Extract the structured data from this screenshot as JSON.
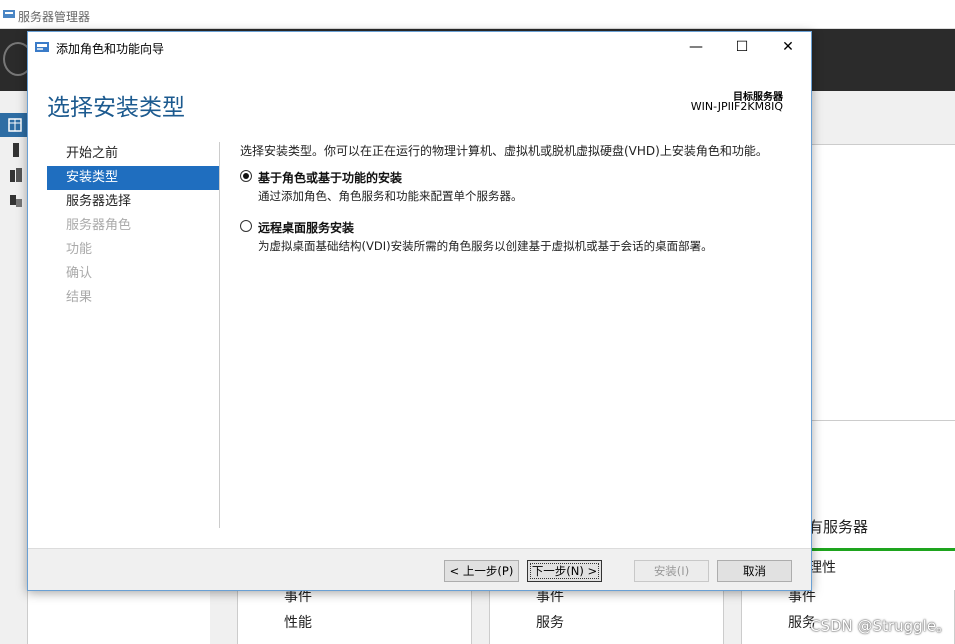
{
  "background": {
    "app_title": "服务器管理器",
    "tiles": [
      {
        "line1": "事件",
        "line2": "性能"
      },
      {
        "line1": "事件",
        "line2": "服务"
      },
      {
        "line1": "事件",
        "line2": "服务"
      }
    ],
    "right_heading": "有服务器",
    "right_prop": "理性",
    "watermark": "CSDN @Struggle。"
  },
  "dialog": {
    "title": "添加角色和功能向导",
    "page_title": "选择安装类型",
    "target_label": "目标服务器",
    "target_name": "WIN-JPIIF2KM8IQ",
    "nav": [
      {
        "label": "开始之前",
        "state": "normal"
      },
      {
        "label": "安装类型",
        "state": "active"
      },
      {
        "label": "服务器选择",
        "state": "normal"
      },
      {
        "label": "服务器角色",
        "state": "disabled"
      },
      {
        "label": "功能",
        "state": "disabled"
      },
      {
        "label": "确认",
        "state": "disabled"
      },
      {
        "label": "结果",
        "state": "disabled"
      }
    ],
    "intro": "选择安装类型。你可以在正在运行的物理计算机、虚拟机或脱机虚拟硬盘(VHD)上安装角色和功能。",
    "options": [
      {
        "title": "基于角色或基于功能的安装",
        "desc": "通过添加角色、角色服务和功能来配置单个服务器。",
        "checked": true
      },
      {
        "title": "远程桌面服务安装",
        "desc": "为虚拟桌面基础结构(VDI)安装所需的角色服务以创建基于虚拟机或基于会话的桌面部署。",
        "checked": false
      }
    ],
    "buttons": {
      "prev": "< 上一步(P)",
      "next": "下一步(N) >",
      "install": "安装(I)",
      "cancel": "取消"
    },
    "window_controls": {
      "minimize": "—",
      "maximize": "☐",
      "close": "✕"
    }
  }
}
